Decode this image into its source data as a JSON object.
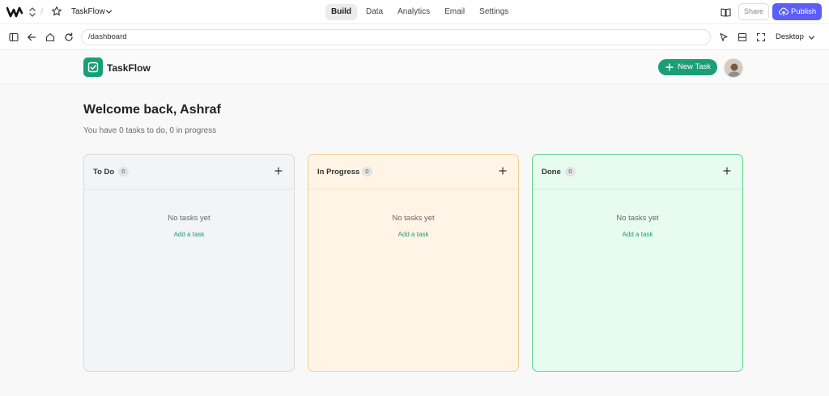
{
  "topbar": {
    "project_name": "TaskFlow",
    "separator": "/",
    "tabs": [
      {
        "label": "Build",
        "active": true
      },
      {
        "label": "Data",
        "active": false
      },
      {
        "label": "Analytics",
        "active": false
      },
      {
        "label": "Email",
        "active": false
      },
      {
        "label": "Settings",
        "active": false
      }
    ],
    "share_label": "Share",
    "publish_label": "Publish"
  },
  "browser": {
    "url": "/dashboard",
    "device_label": "Desktop"
  },
  "app": {
    "brand_name": "TaskFlow",
    "new_task_label": "New Task",
    "welcome": "Welcome back, Ashraf",
    "subtitle": "You have 0 tasks to do, 0 in progress",
    "columns": [
      {
        "title": "To Do",
        "count": "0",
        "empty_text": "No tasks yet",
        "add_text": "Add a task"
      },
      {
        "title": "In Progress",
        "count": "0",
        "empty_text": "No tasks yet",
        "add_text": "Add a task"
      },
      {
        "title": "Done",
        "count": "0",
        "empty_text": "No tasks yet",
        "add_text": "Add a task"
      }
    ]
  },
  "colors": {
    "accent": "#1a9f75",
    "publish": "#5b5ef7",
    "todo_bg": "#f3f4f6",
    "todo_border": "#d9dadc",
    "progress_bg": "#fff4e5",
    "progress_border": "#f5cf92",
    "done_bg": "#e8fbef",
    "done_border": "#5fd58e"
  },
  "icons": [
    "logo-icon",
    "project-switch-icon",
    "star-icon",
    "chevron-down-icon",
    "book-icon",
    "cloud-upload-icon",
    "sidebar-toggle-icon",
    "back-arrow-icon",
    "home-icon",
    "refresh-icon",
    "cursor-icon",
    "layout-icon",
    "fullscreen-icon",
    "checkbox-icon",
    "plus-icon"
  ]
}
